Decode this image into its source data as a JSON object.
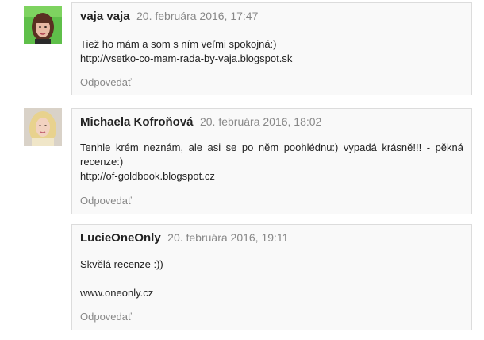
{
  "comments": [
    {
      "author": "vaja vaja",
      "date": "20. februára 2016, 17:47",
      "lines": [
        "Tiež ho mám a som s ním veľmi spokojná:)",
        "http://vsetko-co-mam-rada-by-vaja.blogspot.sk"
      ],
      "reply": "Odpovedať"
    },
    {
      "author": "Michaela Kofroňová",
      "date": "20. februára 2016, 18:02",
      "lines": [
        "Tenhle krém neznám, ale asi se po něm poohlédnu:) vypadá krásně!!! - pěkná recenze:)",
        "http://of-goldbook.blogspot.cz"
      ],
      "reply": "Odpovedať"
    },
    {
      "author": "LucieOneOnly",
      "date": "20. februára 2016, 19:11",
      "lines": [
        "Skvělá recenze :))",
        "",
        "www.oneonly.cz"
      ],
      "reply": "Odpovedať"
    }
  ],
  "avatars": [
    "user-photo-vaja",
    "user-photo-michaela"
  ],
  "colors": {
    "box_bg": "#f9f9f9",
    "box_border": "#dcdcdc",
    "muted": "#888888",
    "text": "#222222"
  }
}
